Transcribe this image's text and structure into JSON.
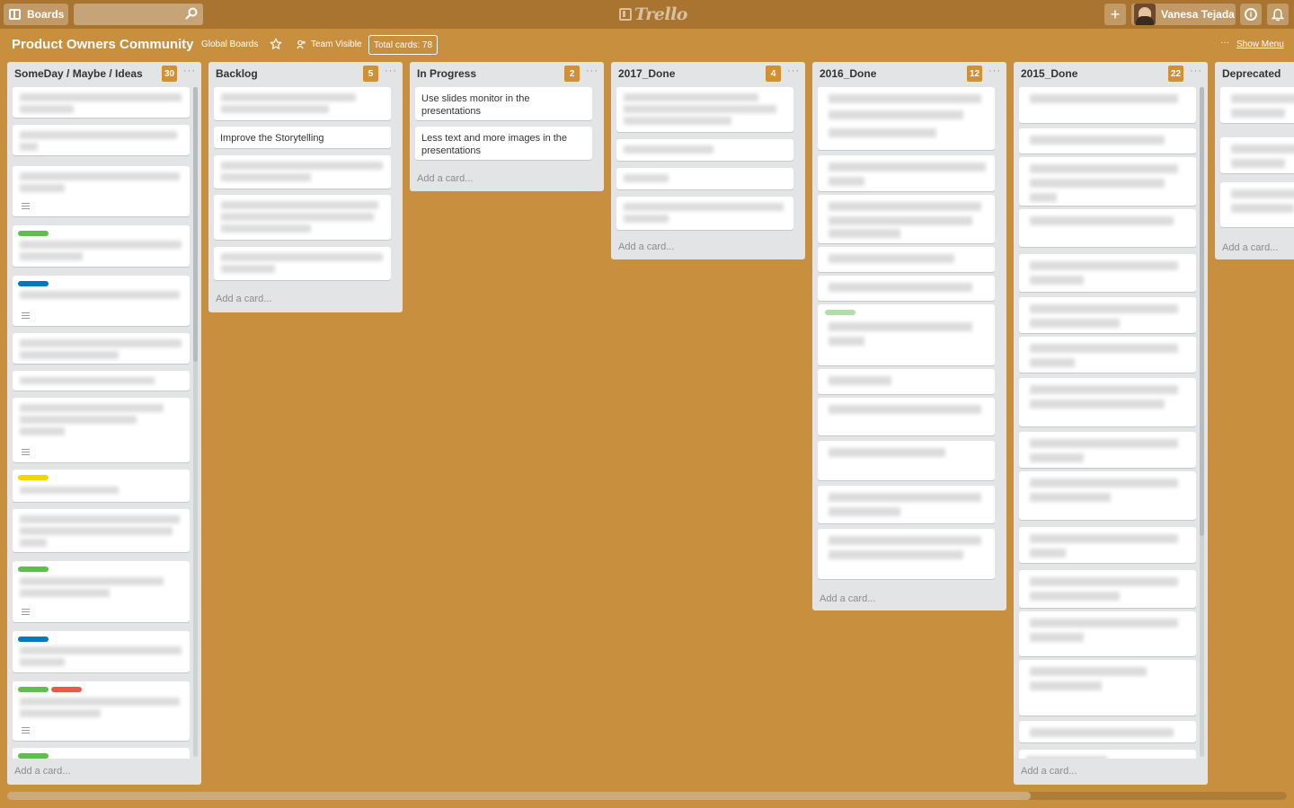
{
  "topbar": {
    "boards_label": "Boards",
    "search_value": "",
    "logo_text": "Trello",
    "plus_glyph": "+",
    "user_name": "Vanesa Tejada",
    "info_glyph": "i"
  },
  "board": {
    "title": "Product Owners Community",
    "team_link": "Global Boards",
    "visibility": "Team Visible",
    "total_cards": "Total cards: 78",
    "menu_dots": "···",
    "show_menu": "Show Menu"
  },
  "add_card_label": "Add a card...",
  "list_menu_glyph": "···",
  "lists": [
    {
      "title": "SomeDay / Maybe / Ideas",
      "count": "30",
      "cards": []
    },
    {
      "title": "Backlog",
      "count": "5",
      "cards": [
        "Improve the Storytelling"
      ]
    },
    {
      "title": "In Progress",
      "count": "2",
      "cards": [
        "Use slides monitor in the presentations",
        "Less text and more images in the presentations"
      ]
    },
    {
      "title": "2017_Done",
      "count": "4",
      "cards": []
    },
    {
      "title": "2016_Done",
      "count": "12",
      "cards": []
    },
    {
      "title": "2015_Done",
      "count": "22",
      "cards": []
    },
    {
      "title": "Deprecated",
      "cards": []
    }
  ],
  "colors": {
    "board_bg": "#C88F3F",
    "topbar_bg": "#A9742F",
    "count_badge": "#D29034",
    "label_green": "#61BD4F",
    "label_blue": "#0079BF",
    "label_yellow": "#F2D600",
    "label_red": "#EB5A46"
  }
}
